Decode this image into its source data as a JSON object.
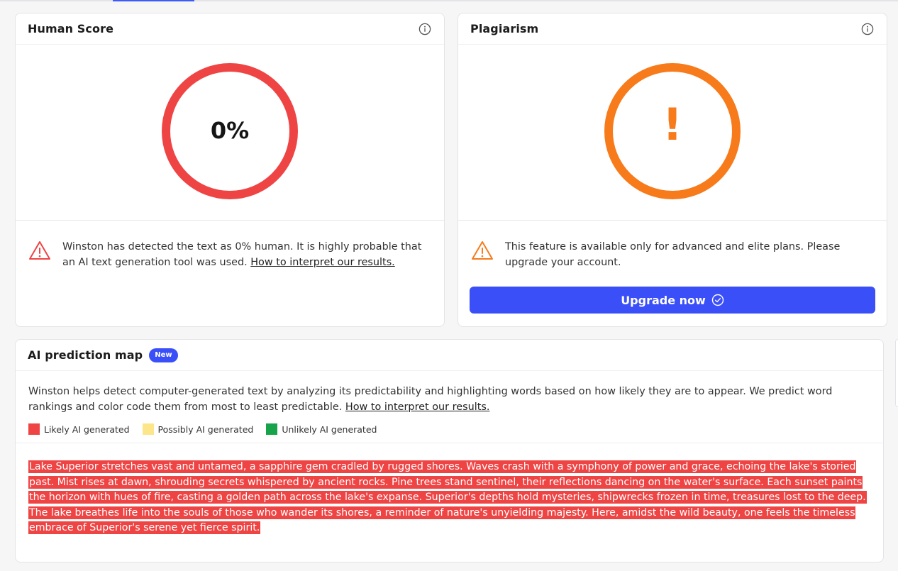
{
  "human_score": {
    "title": "Human Score",
    "value": "0%",
    "score_fraction": 0,
    "ring_color": "#ef4444",
    "message": "Winston has detected the text as 0% human. It is highly probable that an AI text generation tool was used.",
    "link": "How to interpret our results."
  },
  "plagiarism": {
    "title": "Plagiarism",
    "symbol": "!",
    "ring_color": "#f77a1b",
    "message": "This feature is available only for advanced and elite plans. Please upgrade your account.",
    "button_label": "Upgrade now"
  },
  "prediction_map": {
    "title": "AI prediction map",
    "badge": "New",
    "description": "Winston helps detect computer-generated text by analyzing its predictability and highlighting words based on how likely they are to appear. We predict word rankings and color code them from most to least predictable.",
    "link": "How to interpret our results.",
    "legend": [
      {
        "label": "Likely AI generated",
        "color": "#ef4444"
      },
      {
        "label": "Possibly AI generated",
        "color": "#fde68a"
      },
      {
        "label": "Unlikely AI generated",
        "color": "#16a34a"
      }
    ],
    "text": "Lake Superior stretches vast and untamed, a sapphire gem cradled by rugged shores. Waves crash with a symphony of power and grace, echoing the lake's storied past. Mist rises at dawn, shrouding secrets whispered by ancient rocks. Pine trees stand sentinel, their reflections dancing on the water's surface. Each sunset paints the horizon with hues of fire, casting a golden path across the lake's expanse. Superior's depths hold mysteries, shipwrecks frozen in time, treasures lost to the deep. The lake breathes life into the souls of those who wander its shores, a reminder of nature's unyielding majesty. Here, amidst the wild beauty, one feels the timeless embrace of Superior's serene yet fierce spirit."
  }
}
